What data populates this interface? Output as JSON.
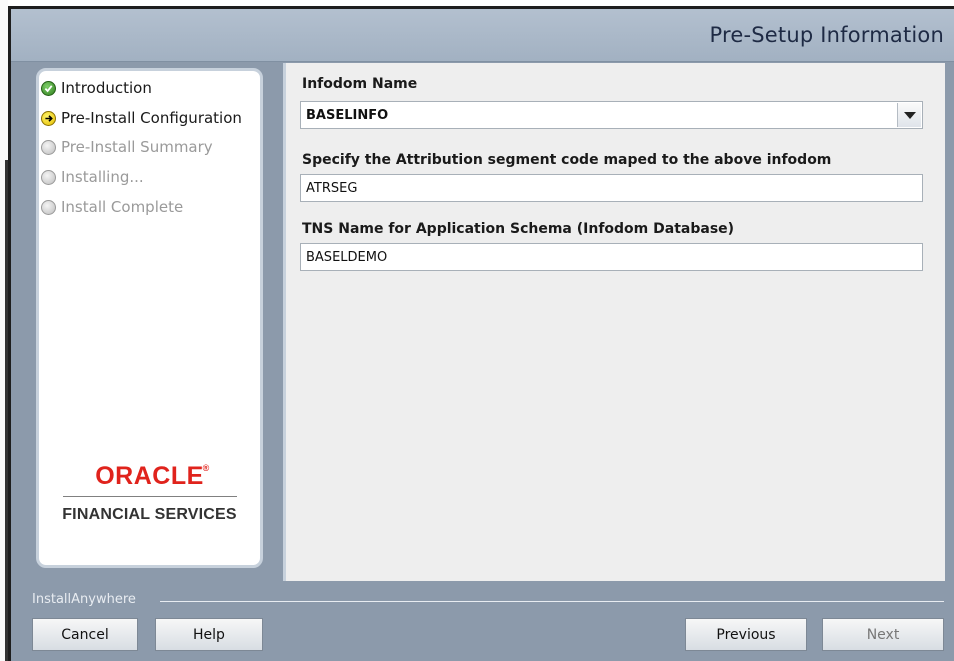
{
  "header": {
    "title": "Pre-Setup Information"
  },
  "sidebar": {
    "steps": [
      {
        "label": "Introduction",
        "state": "done"
      },
      {
        "label": "Pre-Install Configuration",
        "state": "current"
      },
      {
        "label": "Pre-Install Summary",
        "state": "pending"
      },
      {
        "label": "Installing...",
        "state": "pending"
      },
      {
        "label": "Install Complete",
        "state": "pending"
      }
    ],
    "logo": {
      "brand": "ORACLE",
      "reg_mark": "®",
      "subtitle": "FINANCIAL SERVICES"
    }
  },
  "form": {
    "infodom_label": "Infodom Name",
    "infodom_value": "BASELINFO",
    "segment_label": "Specify the Attribution segment code maped to the above infodom",
    "segment_value": "ATRSEG",
    "tns_label": "TNS Name for Application Schema (Infodom Database)",
    "tns_value": "BASELDEMO"
  },
  "footer": {
    "vendor": "InstallAnywhere",
    "cancel": "Cancel",
    "help": "Help",
    "previous": "Previous",
    "next": "Next"
  },
  "colors": {
    "frame": "#8c9aab",
    "header": "#a9b7c8",
    "oracle_red": "#e0231c"
  }
}
